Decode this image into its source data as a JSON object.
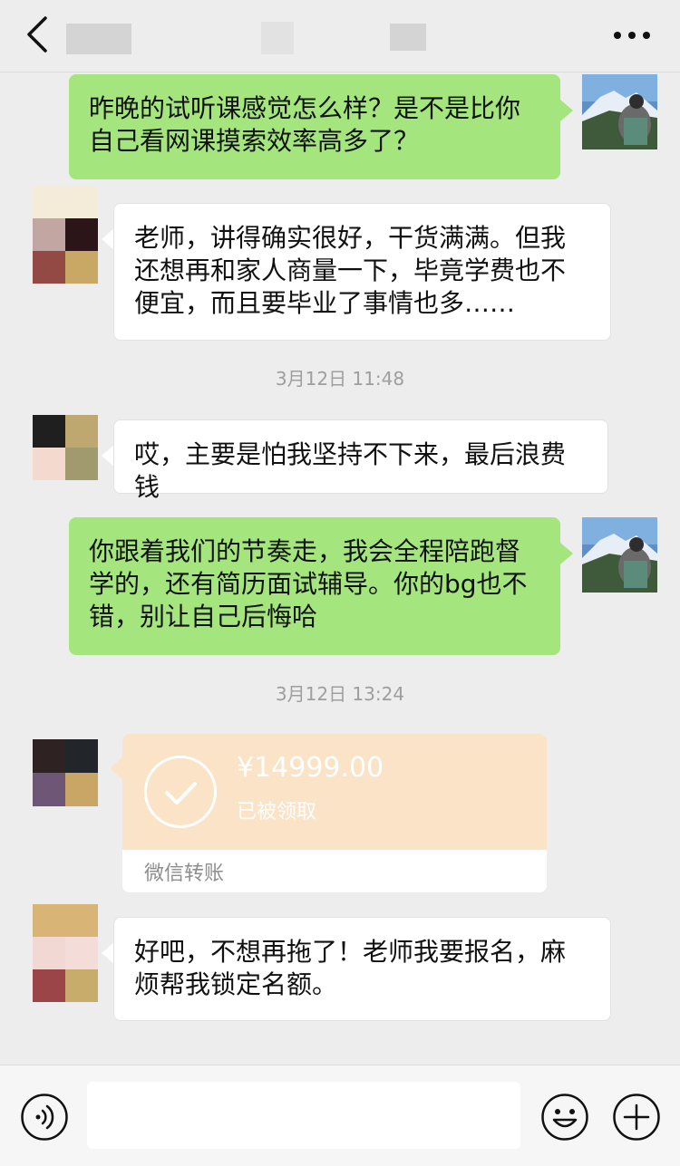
{
  "header": {
    "back_icon": "chevron-left-icon",
    "more_icon": "more-dots-icon"
  },
  "messages": [
    {
      "side": "right",
      "text": "昨晚的试听课感觉怎么样？是不是比你自己看网课摸索效率高多了？"
    },
    {
      "side": "left",
      "text": "老师，讲得确实很好，干货满满。但我还想再和家人商量一下，毕竟学费也不便宜，而且要毕业了事情也多……"
    },
    {
      "side": "left",
      "text": "哎，主要是怕我坚持不下来，最后浪费钱"
    },
    {
      "side": "right",
      "text": "你跟着我们的节奏走，我会全程陪跑督学的，还有简历面试辅导。你的bg也不错，别让自己后悔哈"
    },
    {
      "side": "left",
      "text": "好吧，不想再拖了！老师我要报名，麻烦帮我锁定名额。"
    }
  ],
  "timestamps": [
    "3月12日 11:48",
    "3月12日 13:24"
  ],
  "transfer": {
    "amount": "¥14999.00",
    "status": "已被领取",
    "label": "微信转账",
    "icon": "check-circle-icon"
  },
  "input_bar": {
    "voice_icon": "voice-icon",
    "input_value": "",
    "emoji_icon": "emoji-icon",
    "plus_icon": "plus-circle-icon"
  },
  "colors": {
    "background": "#ededed",
    "sent_bubble": "#a5e57e",
    "received_bubble": "#ffffff",
    "transfer_card": "#fae3c6",
    "timestamp_text": "#9e9e9e"
  }
}
